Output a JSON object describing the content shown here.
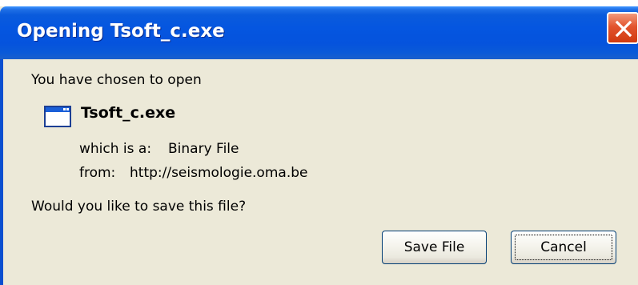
{
  "window": {
    "title": "Opening Tsoft_c.exe"
  },
  "dialog": {
    "intro": "You have chosen to open",
    "file_name": "Tsoft_c.exe",
    "type_label": "which is a:",
    "type_value": "Binary File",
    "from_label": "from:",
    "from_value": "http://seismologie.oma.be",
    "question": "Would you like to save this file?"
  },
  "buttons": {
    "save": "Save File",
    "cancel": "Cancel"
  },
  "icons": {
    "close": "close-icon",
    "file": "application-window-icon"
  },
  "colors": {
    "titlebar": "#0556e0",
    "close": "#e2542e",
    "background": "#ece9d8"
  }
}
